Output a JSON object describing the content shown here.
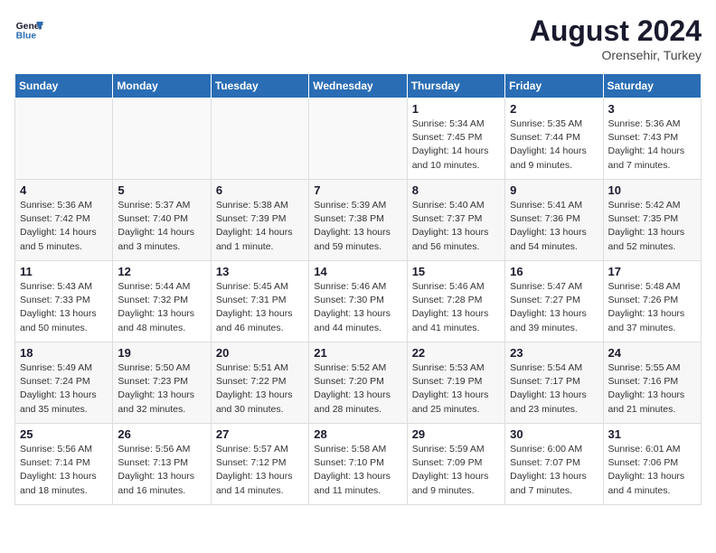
{
  "header": {
    "logo_line1": "General",
    "logo_line2": "Blue",
    "month_year": "August 2024",
    "location": "Orensehir, Turkey"
  },
  "days_of_week": [
    "Sunday",
    "Monday",
    "Tuesday",
    "Wednesday",
    "Thursday",
    "Friday",
    "Saturday"
  ],
  "weeks": [
    [
      {
        "day": "",
        "info": ""
      },
      {
        "day": "",
        "info": ""
      },
      {
        "day": "",
        "info": ""
      },
      {
        "day": "",
        "info": ""
      },
      {
        "day": "1",
        "info": "Sunrise: 5:34 AM\nSunset: 7:45 PM\nDaylight: 14 hours\nand 10 minutes."
      },
      {
        "day": "2",
        "info": "Sunrise: 5:35 AM\nSunset: 7:44 PM\nDaylight: 14 hours\nand 9 minutes."
      },
      {
        "day": "3",
        "info": "Sunrise: 5:36 AM\nSunset: 7:43 PM\nDaylight: 14 hours\nand 7 minutes."
      }
    ],
    [
      {
        "day": "4",
        "info": "Sunrise: 5:36 AM\nSunset: 7:42 PM\nDaylight: 14 hours\nand 5 minutes."
      },
      {
        "day": "5",
        "info": "Sunrise: 5:37 AM\nSunset: 7:40 PM\nDaylight: 14 hours\nand 3 minutes."
      },
      {
        "day": "6",
        "info": "Sunrise: 5:38 AM\nSunset: 7:39 PM\nDaylight: 14 hours\nand 1 minute."
      },
      {
        "day": "7",
        "info": "Sunrise: 5:39 AM\nSunset: 7:38 PM\nDaylight: 13 hours\nand 59 minutes."
      },
      {
        "day": "8",
        "info": "Sunrise: 5:40 AM\nSunset: 7:37 PM\nDaylight: 13 hours\nand 56 minutes."
      },
      {
        "day": "9",
        "info": "Sunrise: 5:41 AM\nSunset: 7:36 PM\nDaylight: 13 hours\nand 54 minutes."
      },
      {
        "day": "10",
        "info": "Sunrise: 5:42 AM\nSunset: 7:35 PM\nDaylight: 13 hours\nand 52 minutes."
      }
    ],
    [
      {
        "day": "11",
        "info": "Sunrise: 5:43 AM\nSunset: 7:33 PM\nDaylight: 13 hours\nand 50 minutes."
      },
      {
        "day": "12",
        "info": "Sunrise: 5:44 AM\nSunset: 7:32 PM\nDaylight: 13 hours\nand 48 minutes."
      },
      {
        "day": "13",
        "info": "Sunrise: 5:45 AM\nSunset: 7:31 PM\nDaylight: 13 hours\nand 46 minutes."
      },
      {
        "day": "14",
        "info": "Sunrise: 5:46 AM\nSunset: 7:30 PM\nDaylight: 13 hours\nand 44 minutes."
      },
      {
        "day": "15",
        "info": "Sunrise: 5:46 AM\nSunset: 7:28 PM\nDaylight: 13 hours\nand 41 minutes."
      },
      {
        "day": "16",
        "info": "Sunrise: 5:47 AM\nSunset: 7:27 PM\nDaylight: 13 hours\nand 39 minutes."
      },
      {
        "day": "17",
        "info": "Sunrise: 5:48 AM\nSunset: 7:26 PM\nDaylight: 13 hours\nand 37 minutes."
      }
    ],
    [
      {
        "day": "18",
        "info": "Sunrise: 5:49 AM\nSunset: 7:24 PM\nDaylight: 13 hours\nand 35 minutes."
      },
      {
        "day": "19",
        "info": "Sunrise: 5:50 AM\nSunset: 7:23 PM\nDaylight: 13 hours\nand 32 minutes."
      },
      {
        "day": "20",
        "info": "Sunrise: 5:51 AM\nSunset: 7:22 PM\nDaylight: 13 hours\nand 30 minutes."
      },
      {
        "day": "21",
        "info": "Sunrise: 5:52 AM\nSunset: 7:20 PM\nDaylight: 13 hours\nand 28 minutes."
      },
      {
        "day": "22",
        "info": "Sunrise: 5:53 AM\nSunset: 7:19 PM\nDaylight: 13 hours\nand 25 minutes."
      },
      {
        "day": "23",
        "info": "Sunrise: 5:54 AM\nSunset: 7:17 PM\nDaylight: 13 hours\nand 23 minutes."
      },
      {
        "day": "24",
        "info": "Sunrise: 5:55 AM\nSunset: 7:16 PM\nDaylight: 13 hours\nand 21 minutes."
      }
    ],
    [
      {
        "day": "25",
        "info": "Sunrise: 5:56 AM\nSunset: 7:14 PM\nDaylight: 13 hours\nand 18 minutes."
      },
      {
        "day": "26",
        "info": "Sunrise: 5:56 AM\nSunset: 7:13 PM\nDaylight: 13 hours\nand 16 minutes."
      },
      {
        "day": "27",
        "info": "Sunrise: 5:57 AM\nSunset: 7:12 PM\nDaylight: 13 hours\nand 14 minutes."
      },
      {
        "day": "28",
        "info": "Sunrise: 5:58 AM\nSunset: 7:10 PM\nDaylight: 13 hours\nand 11 minutes."
      },
      {
        "day": "29",
        "info": "Sunrise: 5:59 AM\nSunset: 7:09 PM\nDaylight: 13 hours\nand 9 minutes."
      },
      {
        "day": "30",
        "info": "Sunrise: 6:00 AM\nSunset: 7:07 PM\nDaylight: 13 hours\nand 7 minutes."
      },
      {
        "day": "31",
        "info": "Sunrise: 6:01 AM\nSunset: 7:06 PM\nDaylight: 13 hours\nand 4 minutes."
      }
    ]
  ]
}
